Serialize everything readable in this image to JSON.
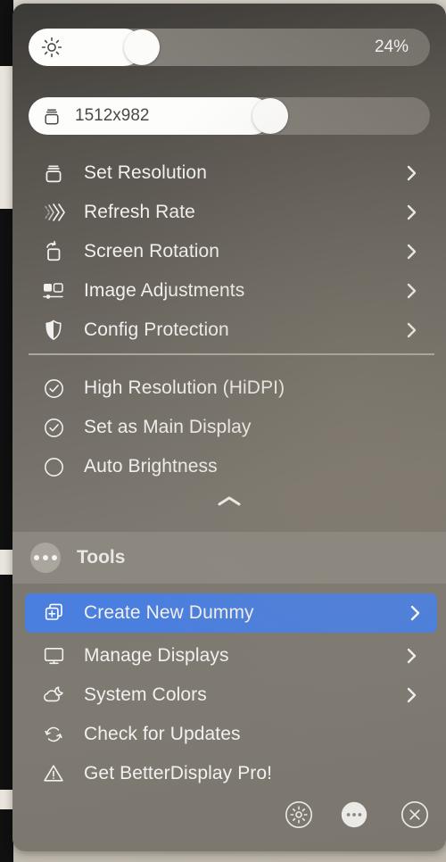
{
  "app": {
    "name": "BetterDisplay"
  },
  "brightness": {
    "icon": "sun-icon",
    "value_label": "24%",
    "percent": 24
  },
  "resolution": {
    "icon": "display-stack-icon",
    "value_label": "1512x982",
    "percent": 56
  },
  "menu": {
    "items": [
      {
        "label": "Set Resolution",
        "icon": "display-stack-icon",
        "chevron": true
      },
      {
        "label": "Refresh Rate",
        "icon": "refresh-rate-icon",
        "chevron": true
      },
      {
        "label": "Screen Rotation",
        "icon": "screen-rotation-icon",
        "chevron": true
      },
      {
        "label": "Image Adjustments",
        "icon": "image-adjustments-icon",
        "chevron": true
      },
      {
        "label": "Config Protection",
        "icon": "shield-icon",
        "chevron": true
      }
    ]
  },
  "toggles": {
    "items": [
      {
        "label": "High Resolution (HiDPI)",
        "icon": "check-circle-icon",
        "checked": true
      },
      {
        "label": "Set as Main Display",
        "icon": "check-circle-icon",
        "checked": true
      },
      {
        "label": "Auto Brightness",
        "icon": "empty-circle-icon",
        "checked": false
      }
    ]
  },
  "collapse": {
    "icon": "chevron-up-icon"
  },
  "tools": {
    "label": "Tools",
    "icon": "ellipsis-circle-icon"
  },
  "actions": {
    "items": [
      {
        "label": "Create New Dummy",
        "icon": "create-dummy-icon",
        "chevron": true,
        "selected": true
      },
      {
        "label": "Manage Displays",
        "icon": "monitor-icon",
        "chevron": true,
        "selected": false
      },
      {
        "label": "System Colors",
        "icon": "cloud-moon-icon",
        "chevron": true,
        "selected": false
      },
      {
        "label": "Check for Updates",
        "icon": "sync-icon",
        "chevron": false,
        "selected": false
      },
      {
        "label": "Get BetterDisplay Pro!",
        "icon": "warning-icon",
        "chevron": false,
        "selected": false
      }
    ]
  },
  "footer": {
    "buttons": [
      {
        "name": "settings",
        "icon": "gear-icon"
      },
      {
        "name": "more",
        "icon": "ellipsis-icon"
      },
      {
        "name": "close",
        "icon": "close-icon"
      }
    ]
  },
  "colors": {
    "accent": "#4a7fe0",
    "panel_text": "#f2f1ef",
    "slider_fill": "#fdfdfc"
  }
}
